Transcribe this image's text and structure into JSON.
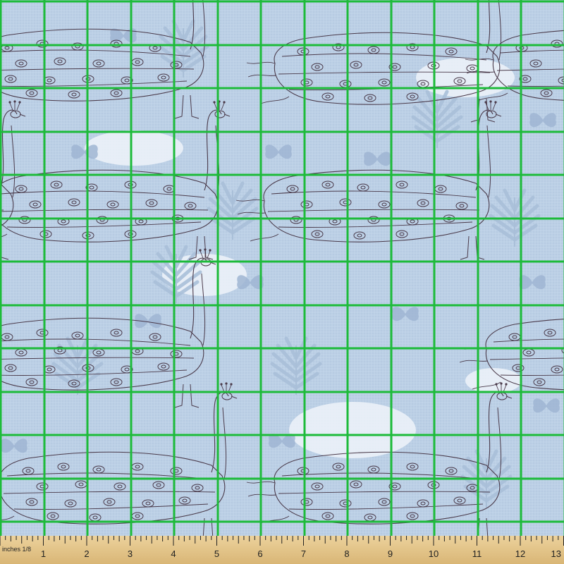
{
  "image": {
    "subject": "peacock-pattern-fabric-swatch",
    "colors": {
      "background": "#bcd0e6",
      "cloud": "#eef3f9",
      "leaf": "#a9bfd8",
      "butterfly": "#9fb5d2",
      "outline": "#4a3a4a",
      "grid": "#1dbb3a",
      "ruler_wood": "#e3c48a",
      "ruler_ink": "#222222"
    }
  },
  "ruler": {
    "unit_label": "inches 1/8",
    "ticks": [
      "1",
      "2",
      "3",
      "4",
      "5",
      "6",
      "7",
      "8",
      "9",
      "10",
      "11",
      "12",
      "13"
    ]
  }
}
